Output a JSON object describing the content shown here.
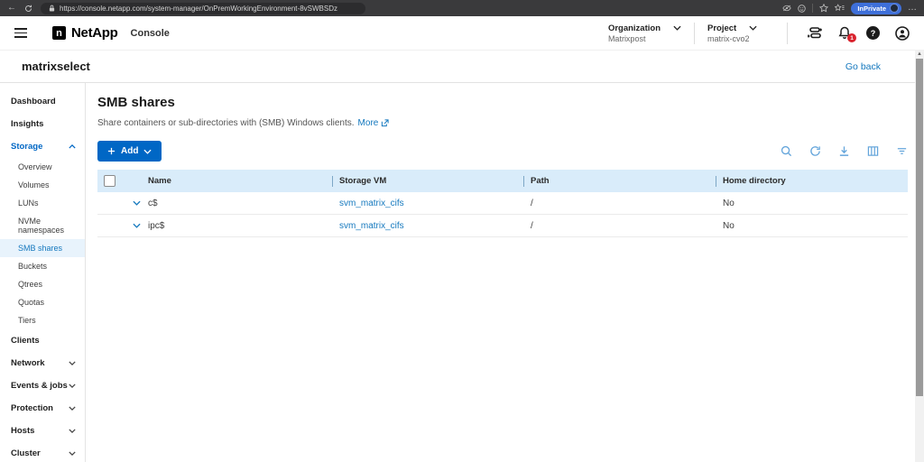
{
  "browser": {
    "url": "https://console.netapp.com/system-manager/OnPremWorkingEnvironment-8vSWBSDz",
    "inprivate_label": "InPrivate",
    "menu_glyph": "…",
    "back_glyph": "←"
  },
  "header": {
    "logo_letter": "n",
    "brand": "NetApp",
    "product": "Console",
    "organization_label": "Organization",
    "organization_value": "Matrixpost",
    "project_label": "Project",
    "project_value": "matrix-cvo2",
    "notification_count": "1",
    "help_glyph": "?"
  },
  "we_bar": {
    "title": "matrixselect",
    "go_back_label": "Go back"
  },
  "sidebar": {
    "items": [
      {
        "label": "Dashboard"
      },
      {
        "label": "Insights"
      },
      {
        "label": "Storage"
      },
      {
        "label": "Overview"
      },
      {
        "label": "Volumes"
      },
      {
        "label": "LUNs"
      },
      {
        "label": "NVMe namespaces"
      },
      {
        "label": "SMB shares"
      },
      {
        "label": "Buckets"
      },
      {
        "label": "Qtrees"
      },
      {
        "label": "Quotas"
      },
      {
        "label": "Tiers"
      },
      {
        "label": "Clients"
      },
      {
        "label": "Network"
      },
      {
        "label": "Events & jobs"
      },
      {
        "label": "Protection"
      },
      {
        "label": "Hosts"
      },
      {
        "label": "Cluster"
      }
    ]
  },
  "main": {
    "title": "SMB shares",
    "description": "Share containers or sub-directories with (SMB) Windows clients.",
    "more_label": "More",
    "add_button_label": "Add",
    "table": {
      "columns": [
        "Name",
        "Storage VM",
        "Path",
        "Home directory"
      ],
      "rows": [
        {
          "name": "c$",
          "storage_vm": "svm_matrix_cifs",
          "path": "/",
          "home_directory": "No"
        },
        {
          "name": "ipc$",
          "storage_vm": "svm_matrix_cifs",
          "path": "/",
          "home_directory": "No"
        }
      ]
    }
  },
  "colors": {
    "accent": "#0067C5",
    "link": "#1478BE",
    "table_header_bg": "#D9ECFA",
    "selected_nav_bg": "#E8F3FC",
    "notification_badge": "#D9232E",
    "browser_bar_bg": "#3A3A3C",
    "inprivate_pill": "#3E6FD9"
  }
}
